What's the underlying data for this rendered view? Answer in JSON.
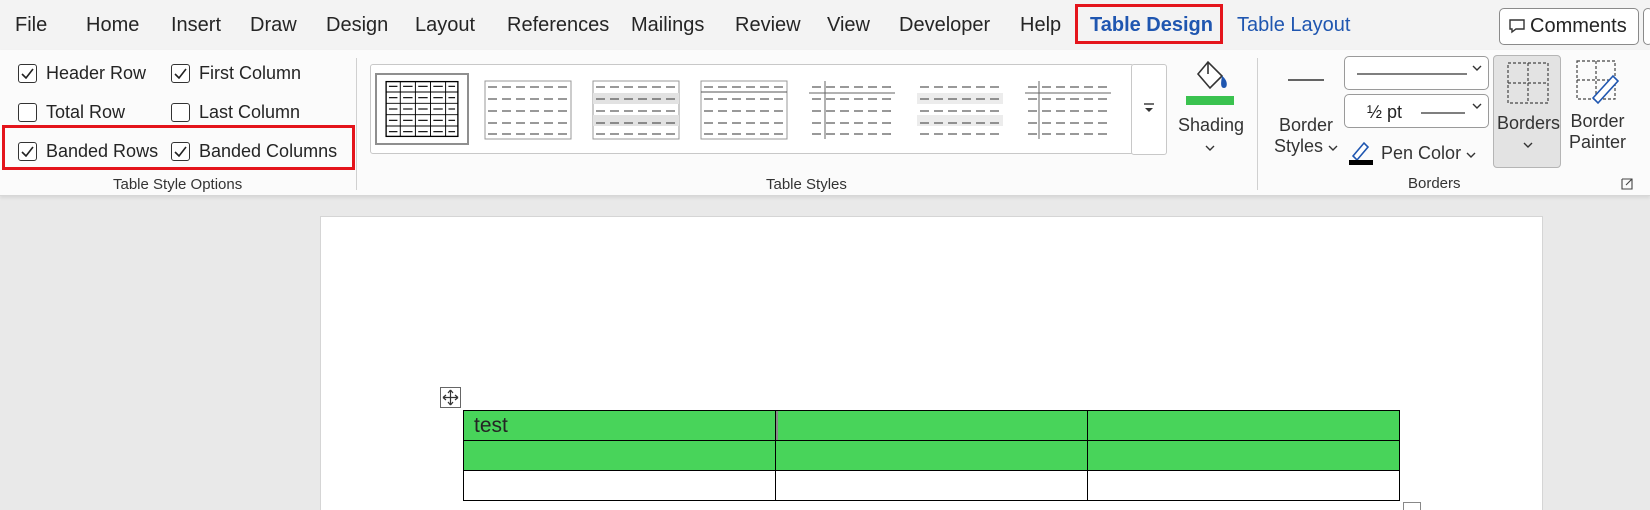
{
  "menu": {
    "tabs": [
      "File",
      "Home",
      "Insert",
      "Draw",
      "Design",
      "Layout",
      "References",
      "Mailings",
      "Review",
      "View",
      "Developer",
      "Help"
    ],
    "context_tabs": [
      "Table Design",
      "Table Layout"
    ],
    "active_tab": "Table Design",
    "comments_label": "Comments"
  },
  "table_style_options": {
    "header_row": {
      "label": "Header Row",
      "checked": true
    },
    "first_column": {
      "label": "First Column",
      "checked": true
    },
    "total_row": {
      "label": "Total Row",
      "checked": false
    },
    "last_column": {
      "label": "Last Column",
      "checked": false
    },
    "banded_rows": {
      "label": "Banded Rows",
      "checked": true
    },
    "banded_columns": {
      "label": "Banded Columns",
      "checked": true
    },
    "group_label": "Table Style Options"
  },
  "table_styles": {
    "group_label": "Table Styles",
    "more_icon": "gallery-more-icon"
  },
  "shading": {
    "label": "Shading",
    "color": "#3ac24f"
  },
  "borders_group": {
    "border_styles_line1": "Border",
    "border_styles_line2": "Styles",
    "line_weight": "½ pt",
    "pen_color_label": "Pen Color",
    "pen_color": "#000000",
    "borders_label": "Borders",
    "border_painter_line1": "Border",
    "border_painter_line2": "Painter",
    "group_label": "Borders"
  },
  "document": {
    "table": {
      "rows": [
        [
          "test",
          "",
          ""
        ],
        [
          "",
          "",
          ""
        ],
        [
          "",
          "",
          ""
        ]
      ],
      "shade_color": "#48d45a"
    }
  },
  "colors": {
    "accent": "#1f56b0",
    "highlight": "#e4141b"
  }
}
